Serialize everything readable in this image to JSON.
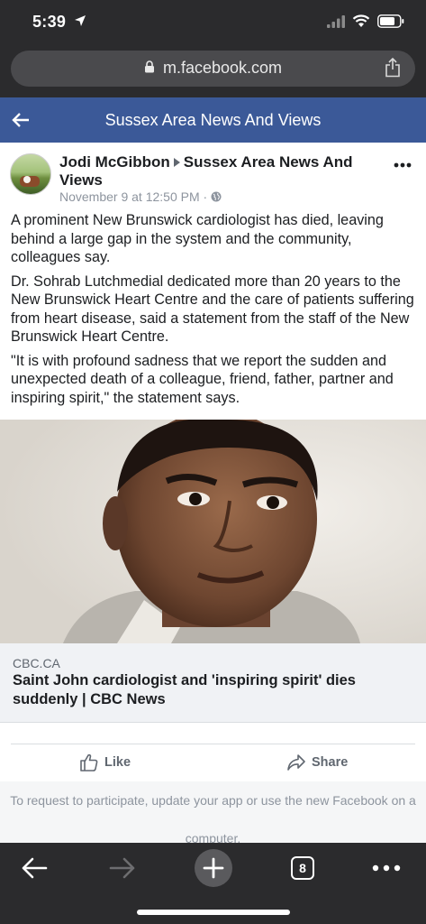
{
  "status_bar": {
    "time": "5:39",
    "icons": [
      "location-arrow-icon",
      "signal-icon",
      "wifi-icon",
      "battery-icon"
    ]
  },
  "browser": {
    "url": "m.facebook.com"
  },
  "header": {
    "title": "Sussex Area News And Views"
  },
  "post": {
    "author": "Jodi McGibbon",
    "group": "Sussex Area News And Views",
    "timestamp": "November 9 at 12:50 PM",
    "separator": "·",
    "paragraphs": [
      "A prominent New Brunswick cardiologist has died, leaving behind a large gap in the system and the community, colleagues say.",
      "Dr. Sohrab Lutchmedial dedicated more than 20 years to the New Brunswick Heart Centre and the care of patients suffering from heart disease, said a statement from the staff of the New Brunswick Heart Centre.",
      "\"It is with profound sadness that we report the sudden and unexpected death of a colleague, friend, father, partner and inspiring spirit,\" the statement says."
    ],
    "link": {
      "domain": "CBC.CA",
      "title": "Saint John cardiologist and 'inspiring spirit' dies suddenly | CBC News"
    },
    "actions": {
      "like": "Like",
      "share": "Share"
    }
  },
  "notice": {
    "line1": "To request to participate, update your app or use the new Facebook on a",
    "line2": "computer."
  },
  "toolbar": {
    "tab_count": "8"
  },
  "colors": {
    "facebook_blue": "#3b5998",
    "browser_chrome": "#2b2b2d"
  }
}
